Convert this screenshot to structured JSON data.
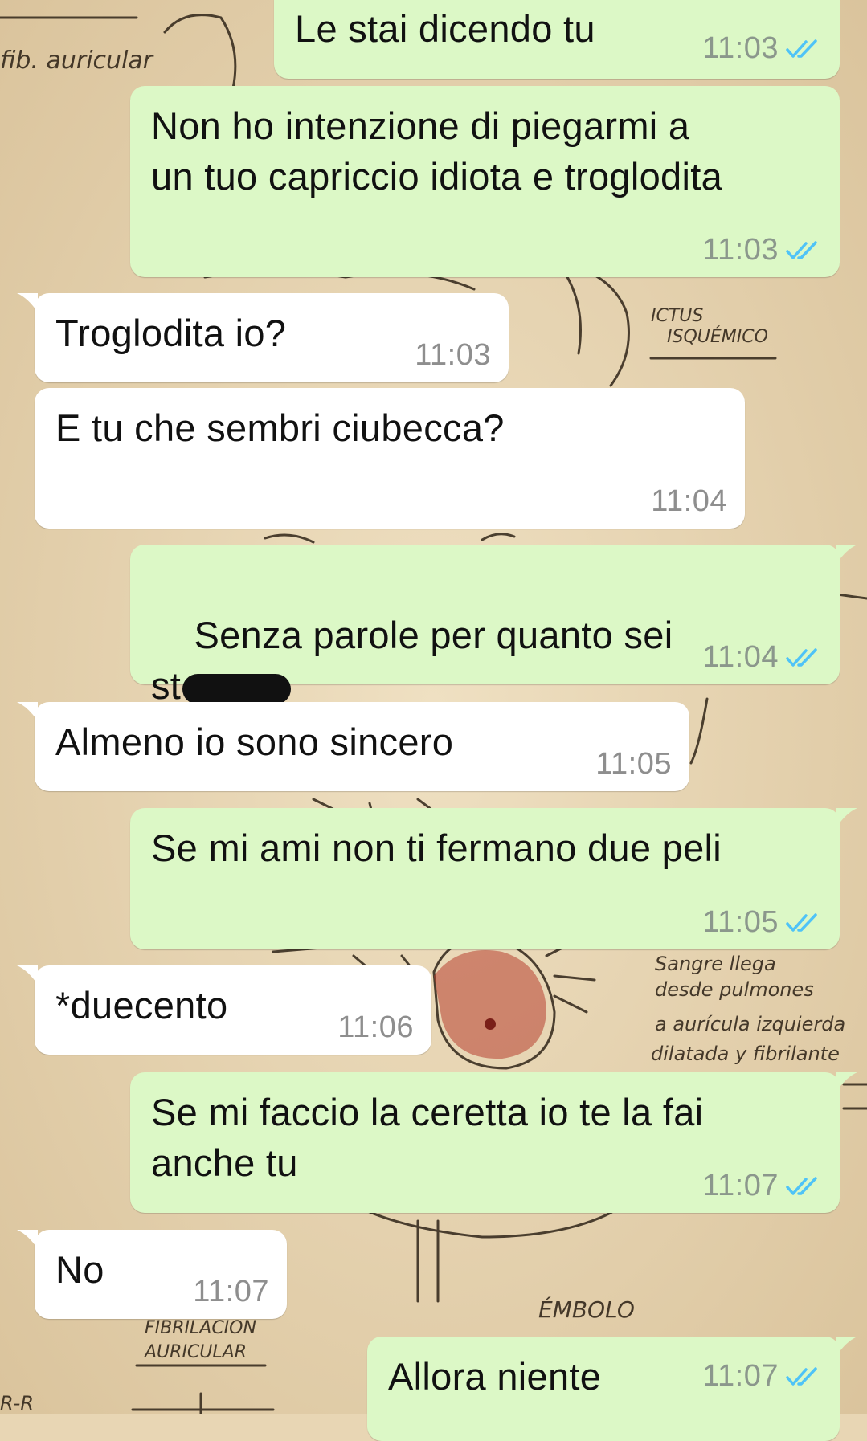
{
  "theme": {
    "outgoing_bg": "#dcf8c6",
    "incoming_bg": "#ffffff",
    "read_tick_color": "#4fc3f7",
    "wallpaper": "#e8d6b4"
  },
  "wallpaper_labels": {
    "l1": "fib. auricular",
    "l2": "ICTUS ISQUÉMICO",
    "l3": "Sangre llega desde pulmones a aurícula izquierda dilatada y fibrilante",
    "l4": "ÉMBOLO",
    "l5": "FIBRILACIÓN AURICULAR",
    "l6": "R-R"
  },
  "messages": [
    {
      "id": "m1",
      "direction": "out",
      "text": "Le stai dicendo tu",
      "time": "11:03",
      "status": "read-ticks-icon"
    },
    {
      "id": "m2",
      "direction": "out",
      "text": "Non ho intenzione di piegarmi a\nun tuo capriccio idiota e troglodita",
      "time": "11:03",
      "status": "read-ticks-icon"
    },
    {
      "id": "m3",
      "direction": "in",
      "text": "Troglodita io?",
      "time": "11:03"
    },
    {
      "id": "m4",
      "direction": "in",
      "text": "E tu che sembri ciubecca?",
      "time": "11:04"
    },
    {
      "id": "m5",
      "direction": "out",
      "text_line1": "Senza parole per quanto sei",
      "text_line2": "st",
      "time": "11:04",
      "status": "read-ticks-icon"
    },
    {
      "id": "m6",
      "direction": "in",
      "text": "Almeno io sono sincero",
      "time": "11:05"
    },
    {
      "id": "m7",
      "direction": "out",
      "text": "Se mi ami non ti fermano due peli",
      "time": "11:05",
      "status": "read-ticks-icon"
    },
    {
      "id": "m8",
      "direction": "in",
      "text": "*duecento",
      "time": "11:06"
    },
    {
      "id": "m9",
      "direction": "out",
      "text": "Se mi faccio la ceretta io te la fai\nanche tu",
      "time": "11:07",
      "status": "read-ticks-icon"
    },
    {
      "id": "m10",
      "direction": "in",
      "text": "No",
      "time": "11:07"
    },
    {
      "id": "m11",
      "direction": "out",
      "text": "Allora niente",
      "time": "11:07",
      "status": "read-ticks-icon"
    }
  ]
}
